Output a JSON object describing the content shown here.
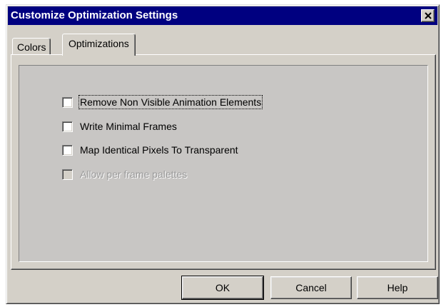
{
  "window": {
    "title": "Customize Optimization Settings"
  },
  "tabs": [
    {
      "label": "Colors",
      "active": false
    },
    {
      "label": "Optimizations",
      "active": true
    }
  ],
  "options": [
    {
      "label": "Remove Non Visible Animation Elements",
      "checked": false,
      "enabled": true,
      "focused": true
    },
    {
      "label": "Write Minimal Frames",
      "checked": false,
      "enabled": true
    },
    {
      "label": "Map Identical Pixels To Transparent",
      "checked": false,
      "enabled": true
    },
    {
      "label": "Allow per frame palettes",
      "checked": false,
      "enabled": false
    }
  ],
  "buttons": {
    "ok": "OK",
    "cancel": "Cancel",
    "help": "Help"
  },
  "colors": {
    "titlebar": "#000080",
    "face": "#d4d0c8",
    "disabled_text": "#9a9a9a"
  },
  "icons": {
    "close": "close-icon"
  }
}
